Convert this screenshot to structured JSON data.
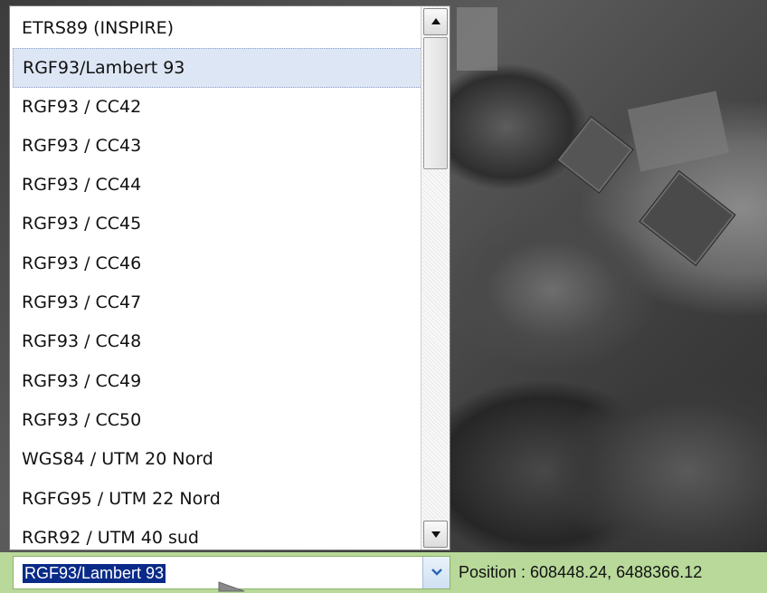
{
  "projection_list": {
    "items": [
      "ETRS89 (INSPIRE)",
      "RGF93/Lambert 93",
      "RGF93 / CC42",
      "RGF93 / CC43",
      "RGF93 / CC44",
      "RGF93 / CC45",
      "RGF93 / CC46",
      "RGF93 / CC47",
      "RGF93 / CC48",
      "RGF93 / CC49",
      "RGF93 / CC50",
      "WGS84 / UTM 20 Nord",
      "RGFG95 / UTM 22 Nord",
      "RGR92 / UTM 40 sud"
    ],
    "selected_index": 1
  },
  "combo": {
    "value": "RGF93/Lambert 93"
  },
  "status": {
    "position": "Position : 608448.24, 6488366.12"
  },
  "icons": {
    "scroll_up": "arrow-up-icon",
    "scroll_down": "arrow-down-icon",
    "combo_dropdown": "chevron-down-icon"
  },
  "colors": {
    "status_bar": "#b8d99a",
    "selection_highlight": "#0a2a88",
    "list_hover": "#dde6f4"
  }
}
